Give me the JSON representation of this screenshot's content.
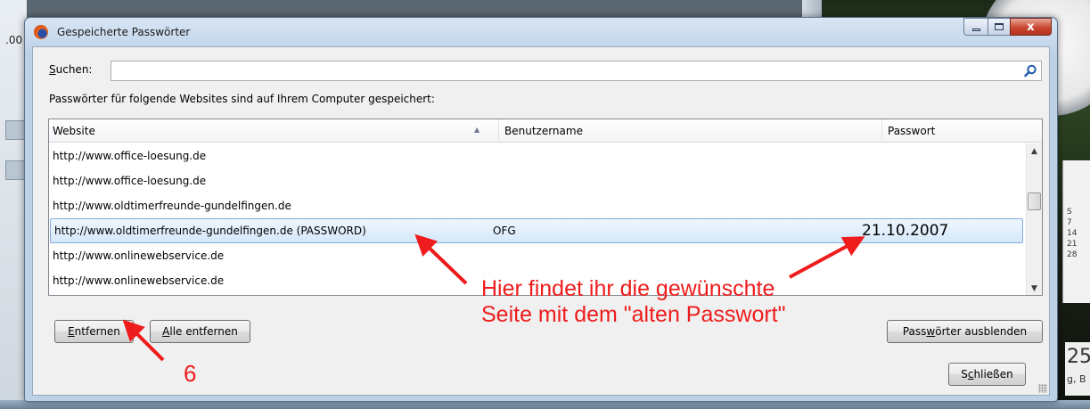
{
  "window": {
    "title": "Gespeicherte Passwörter",
    "close_glyph": "x"
  },
  "search": {
    "label_accesskey": "S",
    "label_rest": "uchen:",
    "value": "",
    "placeholder": ""
  },
  "info_text": "Passwörter für folgende Websites sind auf Ihrem Computer gespeichert:",
  "table": {
    "columns": [
      "Website",
      "Benutzername",
      "Passwort"
    ],
    "sorted_by": "Website",
    "rows": [
      {
        "website": "http://www.office-loesung.de",
        "user": "",
        "password": ""
      },
      {
        "website": "http://www.office-loesung.de",
        "user": "",
        "password": ""
      },
      {
        "website": "http://www.oldtimerfreunde-gundelfingen.de",
        "user": "",
        "password": ""
      },
      {
        "website": "http://www.oldtimerfreunde-gundelfingen.de (PASSWORD)",
        "user": "OFG",
        "password": "21.10.2007",
        "selected": true
      },
      {
        "website": "http://www.onlinewebservice.de",
        "user": "",
        "password": ""
      },
      {
        "website": "http://www.onlinewebservice.de",
        "user": "",
        "password": ""
      }
    ]
  },
  "buttons": {
    "remove": {
      "accesskey": "E",
      "rest": "ntfernen"
    },
    "remove_all": {
      "accesskey": "A",
      "rest": "lle entfernen"
    },
    "hide_passwords": {
      "pre": "Pass",
      "accesskey": "w",
      "rest": "örter ausblenden"
    },
    "close": {
      "pre": "S",
      "accesskey": "c",
      "rest": "hließen"
    }
  },
  "annotations": {
    "main_line1": "Hier findet ihr die gewünschte",
    "main_line2": "Seite mit dem \"alten Passwort\"",
    "step": "6",
    "color": "#ee1c1c"
  },
  "background": {
    "left_text": ".00",
    "calendar": [
      "S",
      "7",
      "14",
      "21",
      "28"
    ],
    "clock_digits": "25",
    "clock_sub": "g, B"
  }
}
